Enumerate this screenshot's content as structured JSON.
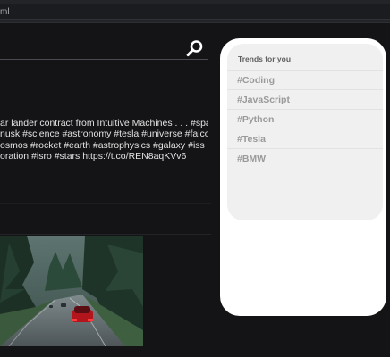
{
  "browser": {
    "url_fragment": "ml"
  },
  "tweet": {
    "lines": [
      "ar lander contract from Intuitive Machines . . . #spacex",
      "nusk #science #astronomy #tesla #universe #falcon",
      "osmos #rocket #earth #astrophysics #galaxy #iss",
      "oration #isro #stars https://t.co/REN8aqKVv6"
    ]
  },
  "trends": {
    "title": "Trends for you",
    "items": [
      "#Coding",
      "#JavaScript",
      "#Python",
      "#Tesla",
      "#BMW"
    ]
  },
  "colors": {
    "page_bg": "#141416",
    "panel_bg": "#ffffff",
    "trends_bg": "#f0f0f0",
    "trend_text": "#9a9a9a"
  },
  "icons": {
    "search": "search-icon"
  }
}
